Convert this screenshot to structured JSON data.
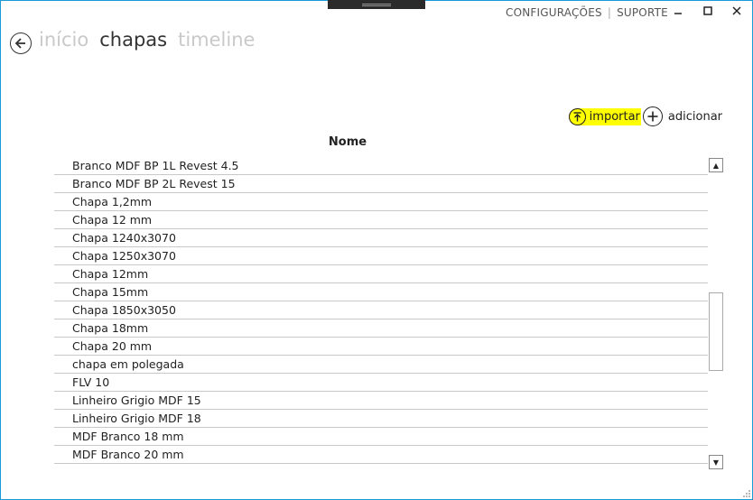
{
  "topnav": {
    "settings": "CONFIGURAÇÕES",
    "separator": "|",
    "support": "SUPORTE"
  },
  "window": {
    "minimize": "—",
    "maximize": "☐",
    "close": "✕"
  },
  "tabs": [
    {
      "label": "início"
    },
    {
      "label": "chapas"
    },
    {
      "label": "timeline"
    }
  ],
  "actions": {
    "import_label": "importar",
    "add_label": "adicionar"
  },
  "table": {
    "header": "Nome",
    "rows": [
      "Branco MDF BP 1L Revest 4.5",
      "Branco MDF BP 2L Revest 15",
      "Chapa 1,2mm",
      "Chapa 12 mm",
      "Chapa 1240x3070",
      "Chapa 1250x3070",
      "Chapa 12mm",
      "Chapa 15mm",
      "Chapa 1850x3050",
      "Chapa 18mm",
      "Chapa 20 mm",
      "chapa em polegada",
      "FLV 10",
      "Linheiro Grigio MDF 15",
      "Linheiro Grigio MDF 18",
      "MDF Branco 18 mm",
      "MDF Branco 20 mm"
    ]
  },
  "scroll_up": "▲",
  "scroll_down": "▼",
  "colors": {
    "frame": "#1a9ad6",
    "highlight": "#ffff00"
  }
}
